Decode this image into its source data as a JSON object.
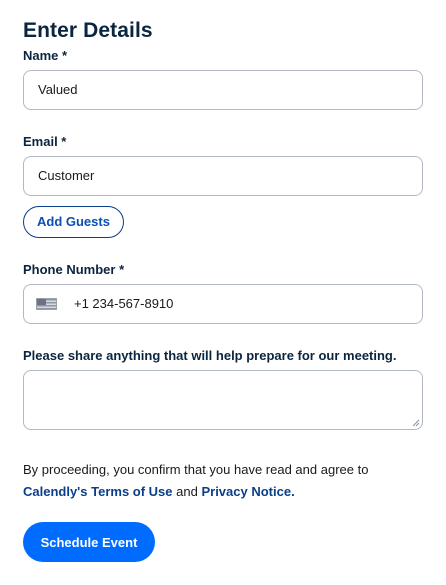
{
  "page": {
    "title": "Enter Details"
  },
  "fields": {
    "name": {
      "label": "Name *",
      "value": "Valued"
    },
    "email": {
      "label": "Email *",
      "value": "Customer"
    },
    "add_guests_label": "Add Guests",
    "phone": {
      "label": "Phone Number *",
      "country_icon": "us-flag-icon",
      "value": "+1 234-567-8910"
    },
    "notes": {
      "label": "Please share anything that will help prepare for our meeting.",
      "value": ""
    }
  },
  "consent": {
    "prefix": "By proceeding, you confirm that you have read and agree to",
    "terms_link": "Calendly's Terms of Use",
    "and_text": "and",
    "privacy_link": "Privacy Notice."
  },
  "submit_label": "Schedule Event",
  "colors": {
    "primary": "#006bff",
    "link": "#0b3e8a",
    "text": "#0a2540",
    "border": "#b2b9c4"
  }
}
